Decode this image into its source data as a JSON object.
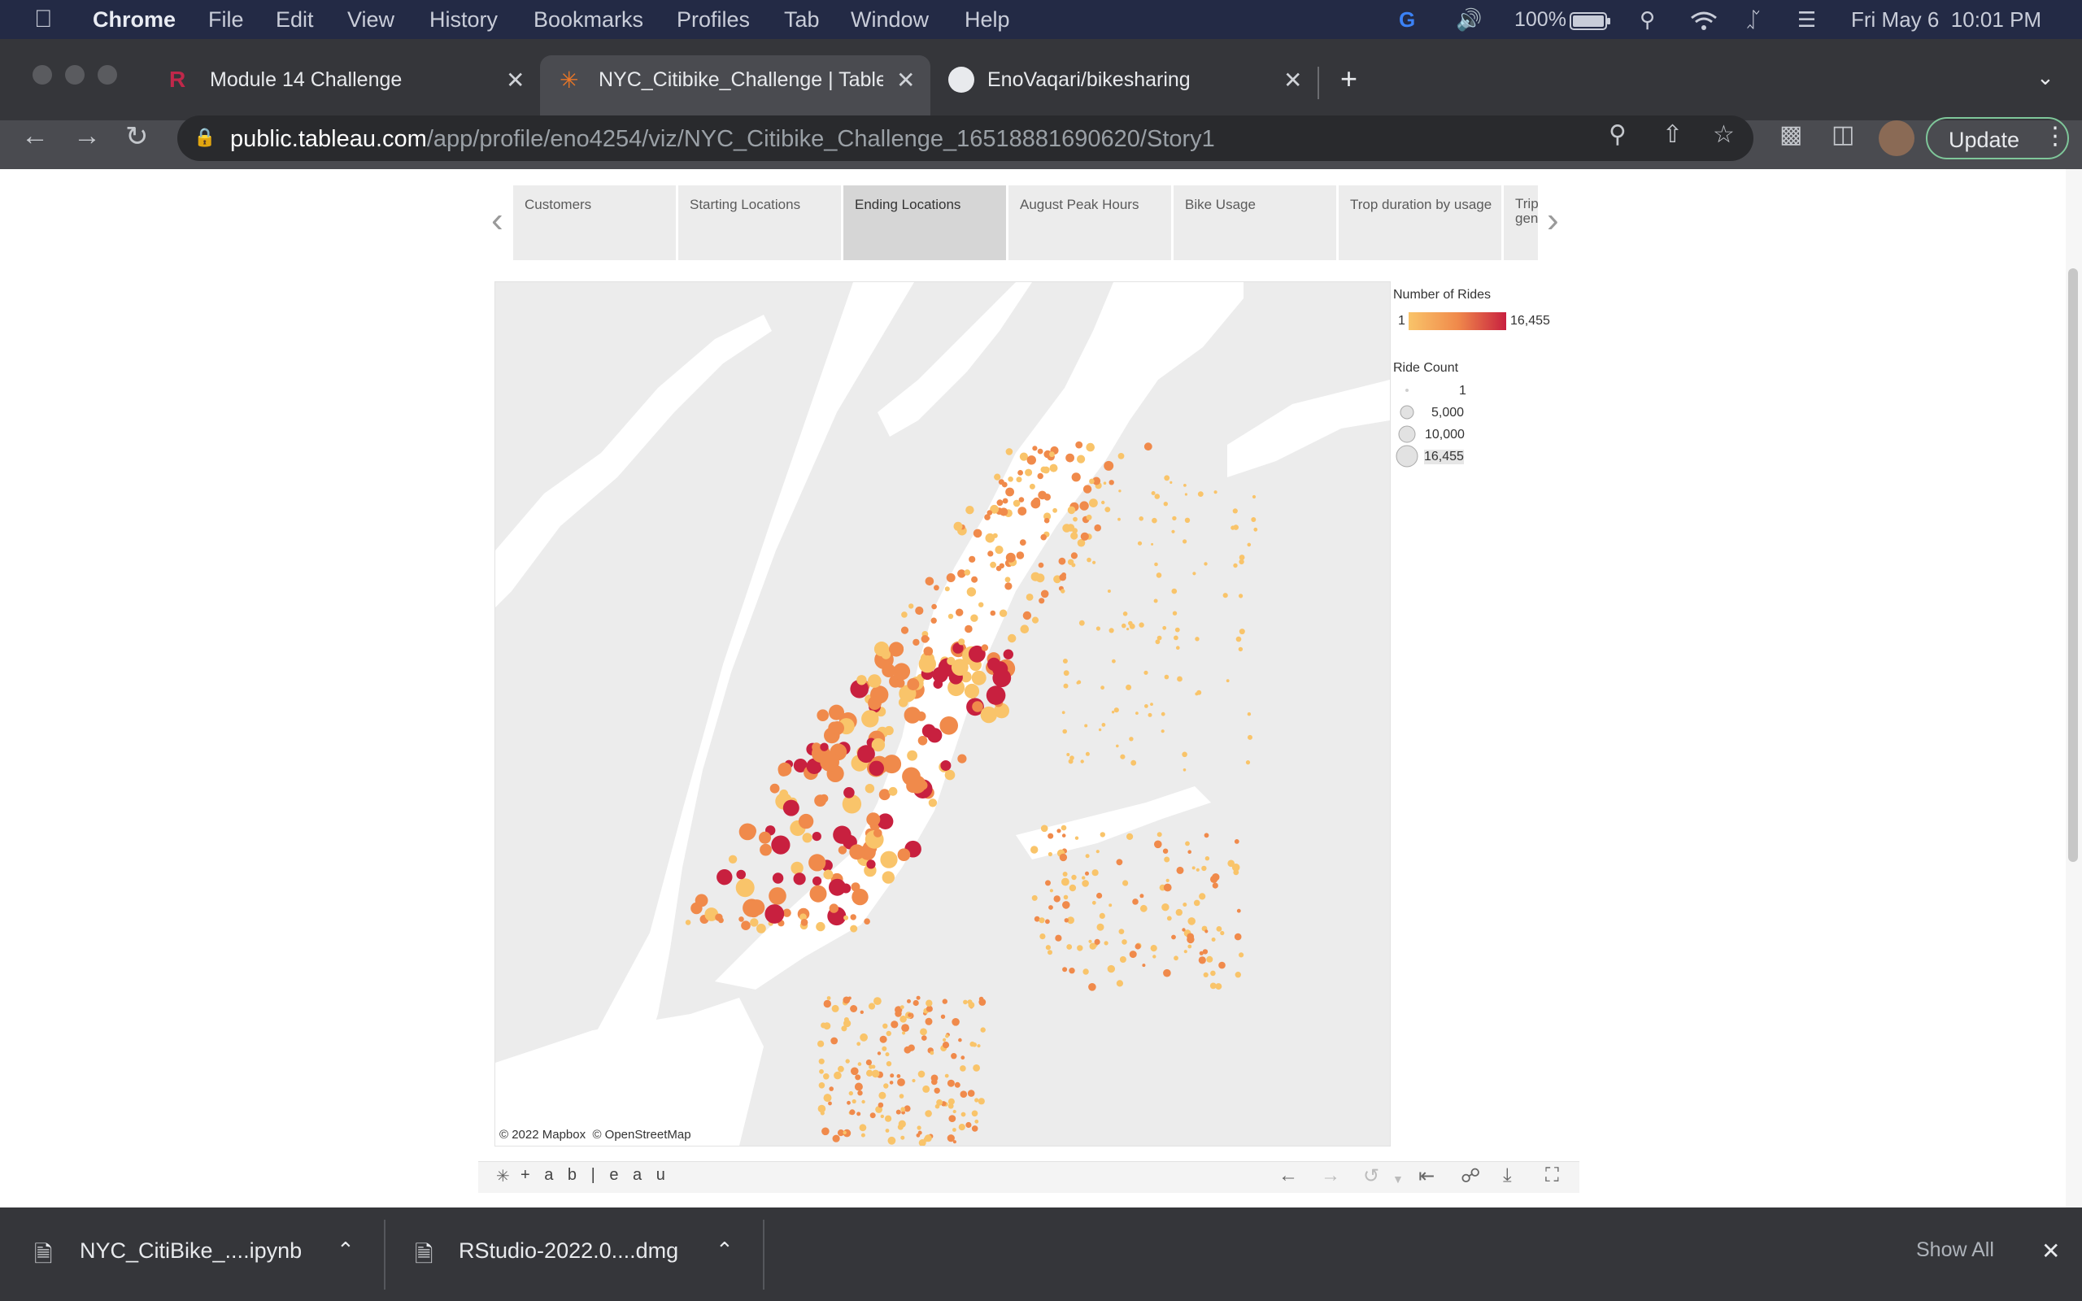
{
  "menubar": {
    "app": "Chrome",
    "items": [
      "File",
      "Edit",
      "View",
      "History",
      "Bookmarks",
      "Profiles",
      "Tab",
      "Window",
      "Help"
    ],
    "battery": "100%",
    "datetime": "Fri May 6  10:01 PM"
  },
  "browser": {
    "tabs": [
      {
        "title": "Module 14 Challenge",
        "icon": "r-icon"
      },
      {
        "title": "NYC_Citibike_Challenge | Tableau Public",
        "icon": "tableau-icon"
      },
      {
        "title": "EnoVaqari/bikesharing",
        "icon": "github-icon"
      }
    ],
    "url_host": "public.tableau.com",
    "url_path": "/app/profile/eno4254/viz/NYC_Citibike_Challenge_16518881690620/Story1",
    "update_label": "Update"
  },
  "story": {
    "points": [
      "Customers",
      "Starting Locations",
      "Ending Locations",
      "August Peak Hours",
      "Bike Usage",
      "Trop duration by usage",
      "Trip gen"
    ],
    "active_index": 2
  },
  "legend": {
    "color_title": "Number of Rides",
    "color_min": "1",
    "color_max": "16,455",
    "size_title": "Ride Count",
    "size_values": [
      "1",
      "5,000",
      "10,000",
      "16,455"
    ],
    "colors": {
      "low": "#f9c46a",
      "mid": "#f08a4b",
      "high": "#c8203f"
    }
  },
  "map": {
    "attribution": "© 2022 Mapbox  © OpenStreetMap"
  },
  "tableau_footer": {
    "logo": "+ a b | e a u"
  },
  "downloads": {
    "items": [
      "NYC_CitiBike_....ipynb",
      "RStudio-2022.0....dmg"
    ],
    "show_all": "Show All"
  }
}
